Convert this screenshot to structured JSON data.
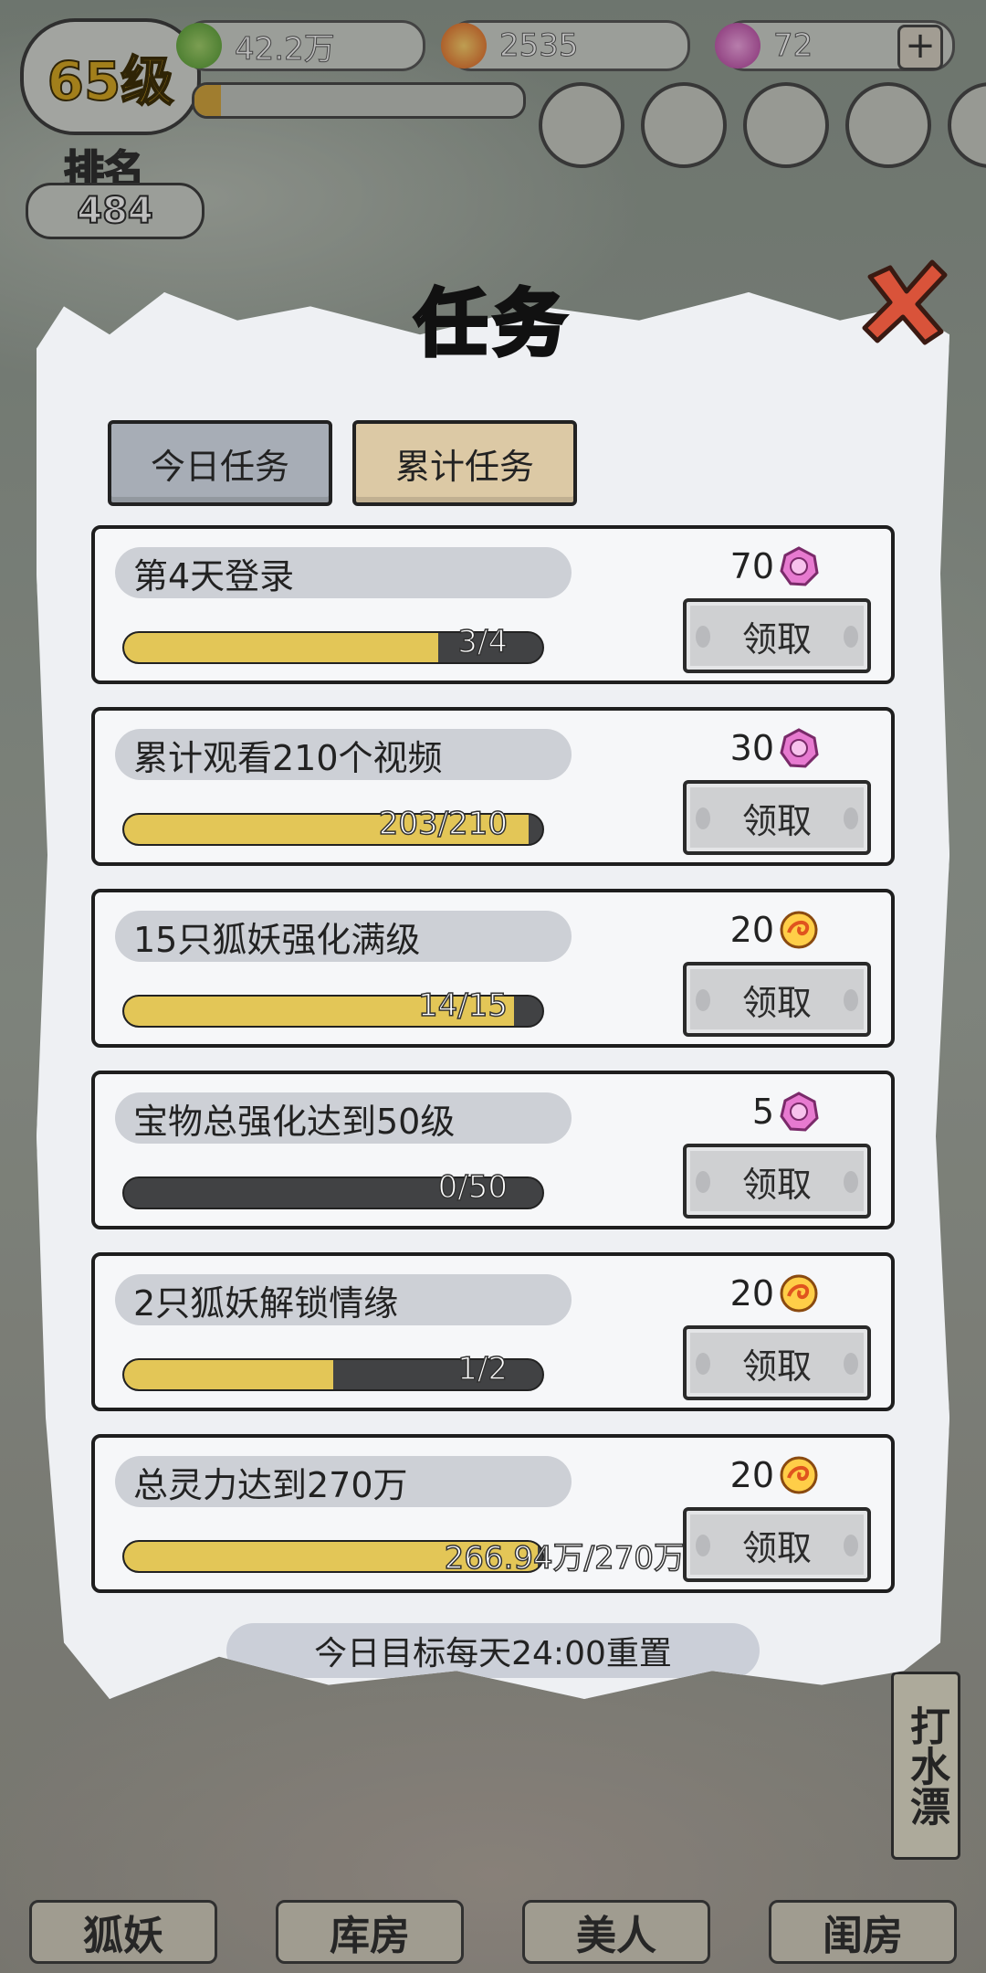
{
  "hud": {
    "level": "65级",
    "rank_label": "排名",
    "rank_value": "484",
    "spirit": "42.2万",
    "coins": "2535",
    "gems": "72",
    "plus": "+"
  },
  "modal": {
    "title": "任务",
    "tabs": [
      {
        "label": "今日任务",
        "active": true
      },
      {
        "label": "累计任务",
        "active": false
      }
    ],
    "tasks": [
      {
        "name": "第4天登录",
        "progress_text": "3/4",
        "progress": 0.75,
        "reward_amount": "70",
        "reward_type": "pink-gem-icon",
        "claim_label": "领取"
      },
      {
        "name": "累计观看210个视频",
        "progress_text": "203/210",
        "progress": 0.967,
        "reward_amount": "30",
        "reward_type": "pink-gem-icon",
        "claim_label": "领取"
      },
      {
        "name": "15只狐妖强化满级",
        "progress_text": "14/15",
        "progress": 0.933,
        "reward_amount": "20",
        "reward_type": "gold-coin-icon",
        "claim_label": "领取"
      },
      {
        "name": "宝物总强化达到50级",
        "progress_text": "0/50",
        "progress": 0.0,
        "reward_amount": "5",
        "reward_type": "pink-gem-icon",
        "claim_label": "领取"
      },
      {
        "name": "2只狐妖解锁情缘",
        "progress_text": "1/2",
        "progress": 0.5,
        "reward_amount": "20",
        "reward_type": "gold-coin-icon",
        "claim_label": "领取"
      },
      {
        "name": "总灵力达到270万",
        "progress_text": "266.94万/270万",
        "progress": 0.989,
        "reward_amount": "20",
        "reward_type": "gold-coin-icon",
        "claim_label": "领取"
      }
    ],
    "reset_note": "今日目标每天24:00重置"
  },
  "bottom_nav": [
    "狐妖",
    "库房",
    "美人",
    "闺房"
  ],
  "side_button": "打水漂",
  "colors": {
    "progress_fill": "#e3c657",
    "progress_track": "#414244",
    "tab_active": "#a7adb6",
    "tab_inactive": "#dcc9a5",
    "close_red": "#d9533a"
  }
}
